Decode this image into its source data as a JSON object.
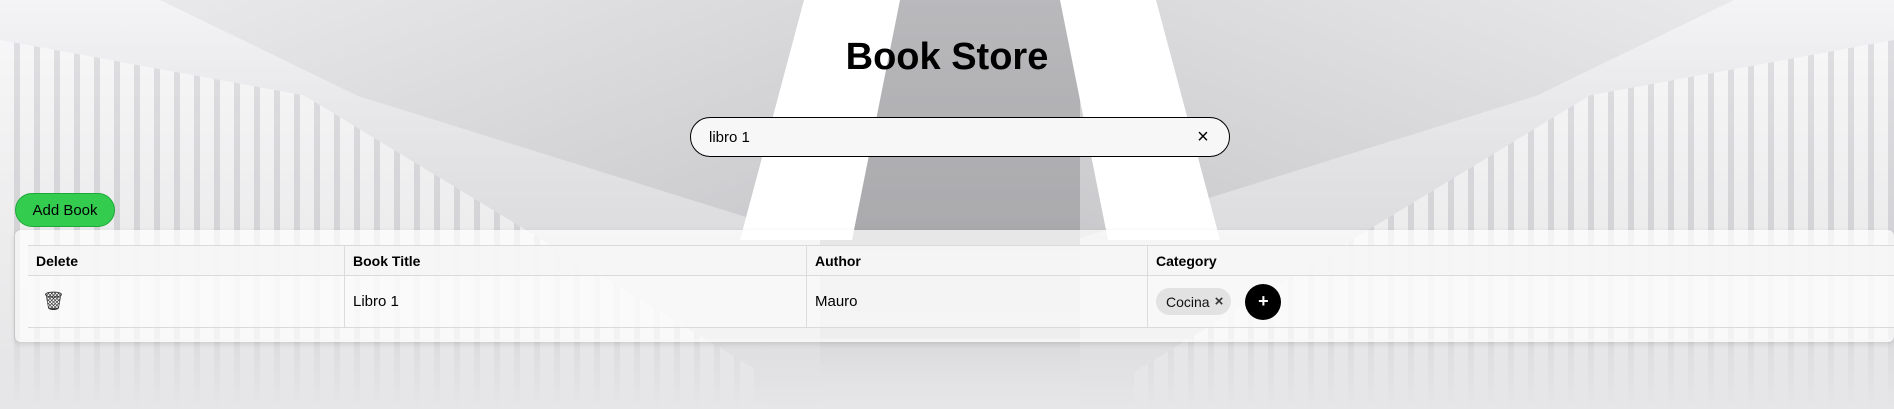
{
  "page": {
    "title": "Book Store"
  },
  "search": {
    "value": "libro 1",
    "clear_icon": "×"
  },
  "actions": {
    "add_book_label": "Add Book"
  },
  "table": {
    "headers": [
      "Delete",
      "Book Title",
      "Author",
      "Category"
    ],
    "rows": [
      {
        "delete_icon": "🗑",
        "title": "Libro 1",
        "author": "Mauro",
        "categories": [
          {
            "label": "Cocina",
            "remove_icon": "×"
          }
        ],
        "add_category_icon": "+"
      }
    ]
  },
  "colors": {
    "add_button": "#33cc4f",
    "add_category_button": "#000000",
    "chip_background": "#e2e2e2"
  }
}
